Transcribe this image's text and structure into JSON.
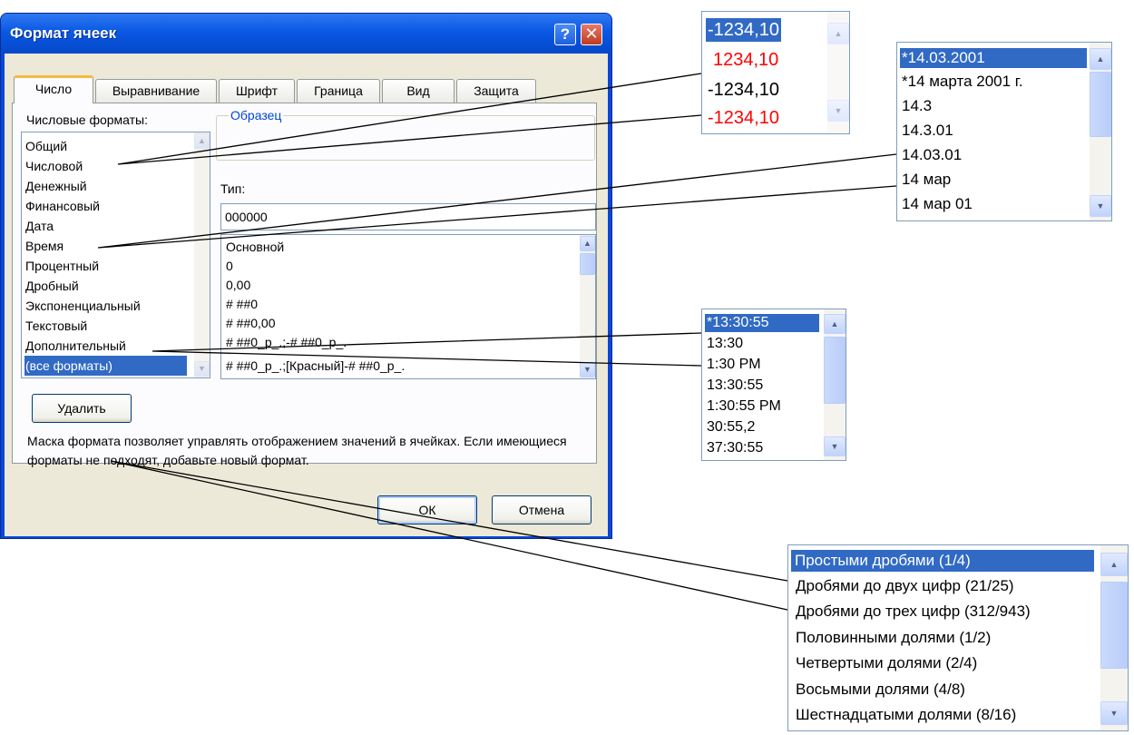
{
  "dialog": {
    "title": "Формат ячеек",
    "help_button": "?",
    "close_button": "✕",
    "tabs": [
      "Число",
      "Выравнивание",
      "Шрифт",
      "Граница",
      "Вид",
      "Защита"
    ],
    "active_tab": "Число",
    "categories_label": "Числовые форматы:",
    "categories": [
      "Общий",
      "Числовой",
      "Денежный",
      "Финансовый",
      "Дата",
      "Время",
      "Процентный",
      "Дробный",
      "Экспоненциальный",
      "Текстовый",
      "Дополнительный",
      "(все форматы)"
    ],
    "selected_category": "(все форматы)",
    "sample_label": "Образец",
    "type_label": "Тип:",
    "type_value": "000000",
    "format_codes": [
      "Основной",
      "0",
      "0,00",
      "# ##0",
      "# ##0,00",
      "# ##0_р_.;-# ##0_р_.",
      "# ##0_р_.;[Красный]-# ##0_р_."
    ],
    "delete_button": "Удалить",
    "description": "Маска формата позволяет управлять отображением значений в ячейках. Если имеющиеся форматы не подходят, добавьте новый формат.",
    "ok_button": "ОК",
    "cancel_button": "Отмена"
  },
  "popups": {
    "number": {
      "items": [
        "-1234,10",
        "1234,10",
        "-1234,10",
        "-1234,10"
      ],
      "colors": [
        "#ffffff",
        "#ff0000",
        "#000000",
        "#ff0000"
      ]
    },
    "date": {
      "items": [
        "*14.03.2001",
        "*14 марта 2001 г.",
        "14.3",
        "14.3.01",
        "14.03.01",
        "14 мар",
        "14 мар 01"
      ]
    },
    "time": {
      "items": [
        "*13:30:55",
        "13:30",
        "1:30 PM",
        "13:30:55",
        "1:30:55 PM",
        "30:55,2",
        "37:30:55"
      ]
    },
    "fraction": {
      "items": [
        "Простыми дробями (1/4)",
        "Дробями до двух цифр (21/25)",
        "Дробями до трех цифр (312/943)",
        "Половинными долями (1/2)",
        "Четвертыми долями (2/4)",
        "Восьмыми долями (4/8)",
        "Шестнадцатыми долями (8/16)"
      ]
    }
  },
  "colors": {
    "selection": "#316ac5",
    "titlebar": "#0a58e4",
    "negative_red": "#ff0000"
  }
}
